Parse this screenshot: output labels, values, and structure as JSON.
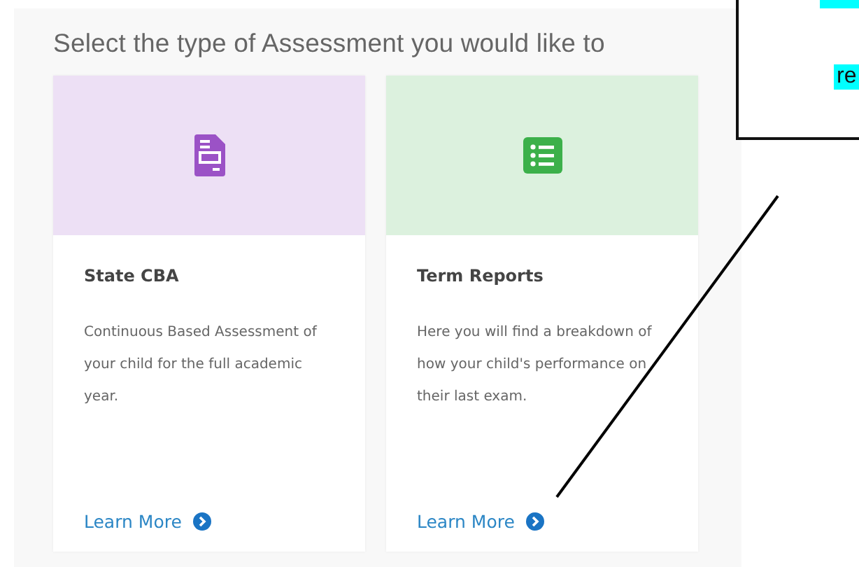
{
  "heading": "Select the type of Assessment you would like to",
  "cards": [
    {
      "kind": "document",
      "color": "#9b52c6",
      "title": "State CBA",
      "description": "Continuous Based Assessment of your child for the full academic year.",
      "link": "Learn More"
    },
    {
      "kind": "list",
      "color": "#3cb04a",
      "title": "Term Reports",
      "description": "Here you will find a breakdown of how your child's performance on their last exam.",
      "link": "Learn More"
    }
  ],
  "callout": {
    "text": "re"
  }
}
